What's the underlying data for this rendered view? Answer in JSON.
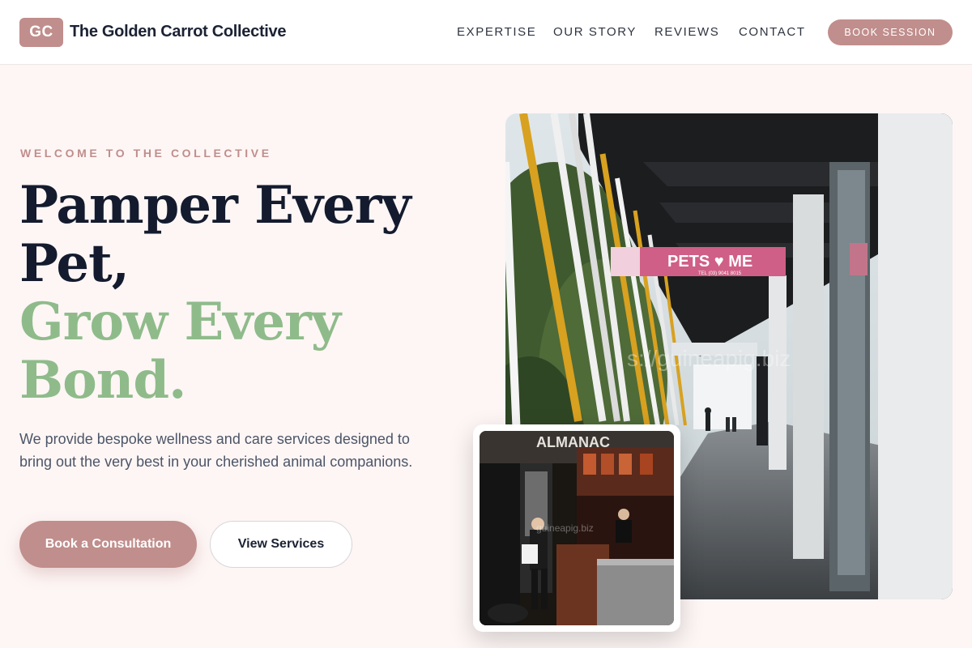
{
  "brand": {
    "logo_initials": "GC",
    "name": "The Golden Carrot Collective"
  },
  "nav": {
    "items": [
      "EXPERTISE",
      "OUR STORY",
      "REVIEWS",
      "CONTACT"
    ],
    "cta": "BOOK SESSION"
  },
  "hero": {
    "eyebrow": "WELCOME TO THE COLLECTIVE",
    "headline_line1": "Pamper Every",
    "headline_line2": "Pet,",
    "headline_line3": "Grow Every",
    "headline_line4": "Bond.",
    "subtext": "We provide bespoke wellness and care services designed to bring out the very best in your cherished animal companions.",
    "primary_button": "Book a Consultation",
    "secondary_button": "View Services"
  },
  "images": {
    "main": {
      "sign_text": "PETS ♥ ME",
      "sign_phone": "TEL (03) 9041 8015",
      "watermark": "s://guineapig.biz"
    },
    "small": {
      "sign_text": "ALMANAC",
      "watermark": "guineapig.biz"
    }
  },
  "colors": {
    "accent": "#c08e8c",
    "green": "#8fbb8a",
    "dark": "#141b2e",
    "background": "#fdf6f5"
  }
}
